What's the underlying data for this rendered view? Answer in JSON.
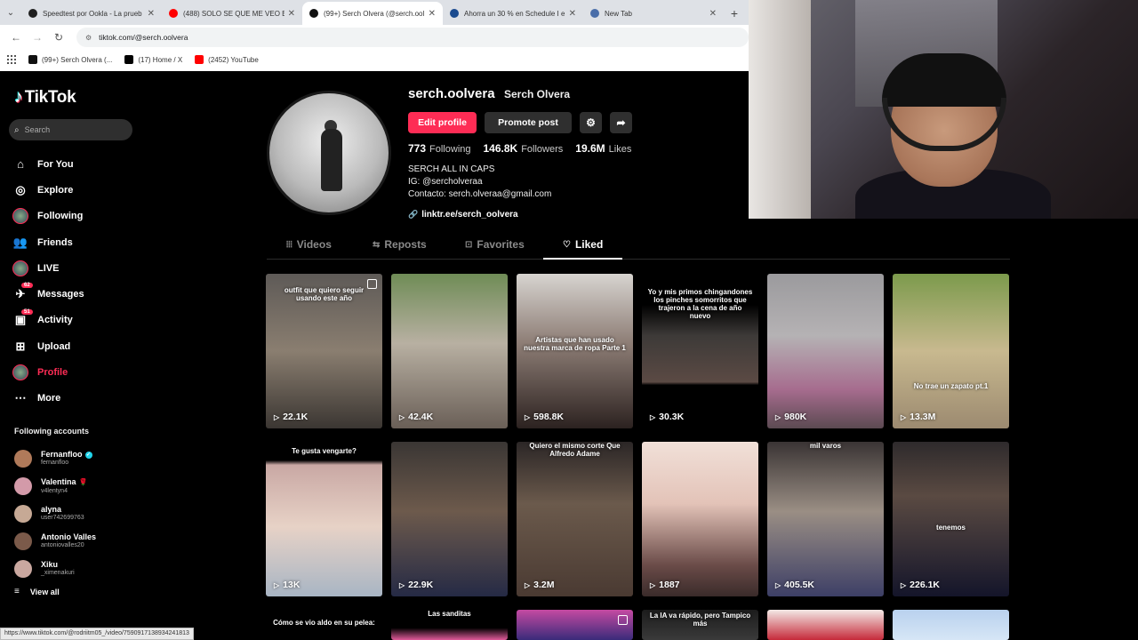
{
  "browser": {
    "tabs": [
      {
        "title": "Speedtest por Ookla - La prueb",
        "color": "#1f1f1f",
        "active": false
      },
      {
        "title": "(488) SOLO SE QUE ME VEO BI",
        "color": "#ff0000",
        "active": false
      },
      {
        "title": "(99+) Serch Olvera (@serch.ool",
        "color": "#111111",
        "active": true
      },
      {
        "title": "Ahorra un 30 % en Schedule I e",
        "color": "#1b4b8f",
        "active": false
      },
      {
        "title": "New Tab",
        "color": "#4a6ea9",
        "active": false
      }
    ],
    "url": "tiktok.com/@serch.oolvera",
    "bookmarks": [
      {
        "label": "(99+) Serch Olvera (...",
        "color": "#111111"
      },
      {
        "label": "(17) Home / X",
        "color": "#000000"
      },
      {
        "label": "(2452) YouTube",
        "color": "#ff0000"
      }
    ],
    "status_url": "https://www.tiktok.com/@rodriitm05_/video/7590917138934241813"
  },
  "sidebar": {
    "logo": "TikTok",
    "search_placeholder": "Search",
    "items": [
      {
        "label": "For You",
        "icon": "home-icon",
        "glyph": "⌂",
        "active": false
      },
      {
        "label": "Explore",
        "icon": "compass-icon",
        "glyph": "◎",
        "active": false
      },
      {
        "label": "Following",
        "icon": "following-avatar",
        "glyph": "",
        "active": false
      },
      {
        "label": "Friends",
        "icon": "friends-icon",
        "glyph": "👥",
        "active": false
      },
      {
        "label": "LIVE",
        "icon": "live-avatar",
        "glyph": "",
        "active": false
      },
      {
        "label": "Messages",
        "icon": "messages-icon",
        "glyph": "✈",
        "active": false,
        "badge": "62"
      },
      {
        "label": "Activity",
        "icon": "activity-icon",
        "glyph": "▣",
        "active": false,
        "badge": "51"
      },
      {
        "label": "Upload",
        "icon": "upload-icon",
        "glyph": "⊞",
        "active": false
      },
      {
        "label": "Profile",
        "icon": "profile-avatar",
        "glyph": "",
        "active": true
      },
      {
        "label": "More",
        "icon": "more-icon",
        "glyph": "⋯",
        "active": false
      }
    ],
    "following_title": "Following accounts",
    "accounts": [
      {
        "name": "Fernanfloo",
        "user": "fernanfloo",
        "color": "#b07a5a",
        "verified": true,
        "emoji": ""
      },
      {
        "name": "Valentina",
        "user": "v4lentyn4",
        "color": "#d39aa9",
        "verified": false,
        "emoji": "🌹"
      },
      {
        "name": "alyna",
        "user": "user742699763",
        "color": "#c6a995",
        "verified": false,
        "emoji": ""
      },
      {
        "name": "Antonio Valles",
        "user": "antoniovalles20",
        "color": "#7b5a4a",
        "verified": false,
        "emoji": ""
      },
      {
        "name": "Xiku",
        "user": "_ximenakuri",
        "color": "#caa8a0",
        "verified": false,
        "emoji": ""
      }
    ],
    "view_all": "View all"
  },
  "profile": {
    "username": "serch.oolvera",
    "display_name": "Serch Olvera",
    "edit_label": "Edit profile",
    "promote_label": "Promote post",
    "following_count": "773",
    "following_label": "Following",
    "followers_count": "146.8K",
    "followers_label": "Followers",
    "likes_count": "19.6M",
    "likes_label": "Likes",
    "bio": [
      "SERCH ALL IN CAPS",
      "IG: @sercholveraa",
      "Contacto: serch.olveraa@gmail.com"
    ],
    "link": "linktr.ee/serch_oolvera"
  },
  "tabs": [
    {
      "label": "Videos",
      "glyph": "⦙⦙⦙"
    },
    {
      "label": "Reposts",
      "glyph": "⇆"
    },
    {
      "label": "Favorites",
      "glyph": "⊡"
    },
    {
      "label": "Liked",
      "glyph": "♡"
    }
  ],
  "videos": [
    {
      "views": "22.1K",
      "caption": "outfit que quiero seguir usando este año",
      "bg": "linear-gradient(180deg,#5e5a57 0%,#8a7e70 50%,#3b3632 100%)",
      "multi": true
    },
    {
      "views": "42.4K",
      "caption": "",
      "bg": "linear-gradient(180deg,#6f8c56 0%,#b8b0a2 45%,#6a5f57 100%)",
      "multi": false
    },
    {
      "views": "598.8K",
      "caption": "Artistas que han usado nuestra marca de ropa Parte 1",
      "bg": "linear-gradient(180deg,#d7d4d0 0%,#8d7d75 45%,#2c2220 100%)",
      "multi": false
    },
    {
      "views": "30.3K",
      "caption": "Yo y mis primos chingandones los pinches somorritos que trajeron a la cena de año nuevo",
      "bg": "linear-gradient(180deg,#000 0%,#000 20%,#3d3a38 40%,#5b4a44 70%,#000 72%,#000 100%)",
      "multi": false
    },
    {
      "views": "980K",
      "caption": "",
      "bg": "linear-gradient(180deg,#9b9a9d 0%,#b5b2b4 40%,#a66c8e 75%,#5c4a52 100%)",
      "multi": false
    },
    {
      "views": "13.3M",
      "caption": "No trae un zapato pt.1",
      "bg": "linear-gradient(180deg,#7c9a4c 0%,#c8b98f 50%,#9c8a70 100%)",
      "multi": false
    },
    {
      "views": "13K",
      "caption": "Te gusta vengarte?",
      "bg": "linear-gradient(180deg,#000 0%,#000 12%,#c9a8a4 15%,#e7d2c6 55%,#a8b5c4 100%)",
      "multi": false
    },
    {
      "views": "22.9K",
      "caption": "",
      "bg": "linear-gradient(180deg,#3a3634 0%,#6d5a4c 45%,#252a45 100%)",
      "multi": false
    },
    {
      "views": "3.2M",
      "caption": "Quiero el mismo corte Que Alfredo Adame",
      "bg": "linear-gradient(180deg,#2b2626 0%,#6b5a4c 40%,#4a3a32 100%)",
      "multi": false
    },
    {
      "views": "1887",
      "caption": "",
      "bg": "linear-gradient(180deg,#f1e0d8 0%,#e3c3b8 40%,#6a4b48 80%,#3a2b2a 100%)",
      "multi": false
    },
    {
      "views": "405.5K",
      "caption": "mil varos",
      "bg": "linear-gradient(180deg,#3a3434 0%,#9a8e84 45%,#3d3f66 100%)",
      "multi": false
    },
    {
      "views": "226.1K",
      "caption": "tenemos",
      "bg": "linear-gradient(180deg,#2e2a2c 0%,#5a4a42 35%,#14152a 100%)",
      "multi": false
    },
    {
      "views": "",
      "caption": "Cómo se vio aldo en su pelea:",
      "bg": "#000",
      "multi": false
    },
    {
      "views": "",
      "caption": "Las sanditas",
      "bg": "linear-gradient(180deg,#000 0%,#000 60%,#e05a9a 100%)",
      "multi": false
    },
    {
      "views": "",
      "caption": "",
      "bg": "linear-gradient(180deg,#c54aa2 0%,#3a2b7a 100%)",
      "multi": true
    },
    {
      "views": "",
      "caption": "La IA va rápido, pero Tampico más",
      "bg": "linear-gradient(180deg,#1c1c1c 0%,#3a3a3a 100%)",
      "multi": false
    },
    {
      "views": "",
      "caption": "",
      "bg": "linear-gradient(180deg,#f3e9e6 0%,#c62a3a 100%)",
      "multi": false
    },
    {
      "views": "",
      "caption": "",
      "bg": "linear-gradient(180deg,#b9d1ee 0%,#d6e6f6 100%)",
      "multi": false
    }
  ],
  "colors": {
    "accent": "#fe2c55",
    "bg": "#000000"
  }
}
